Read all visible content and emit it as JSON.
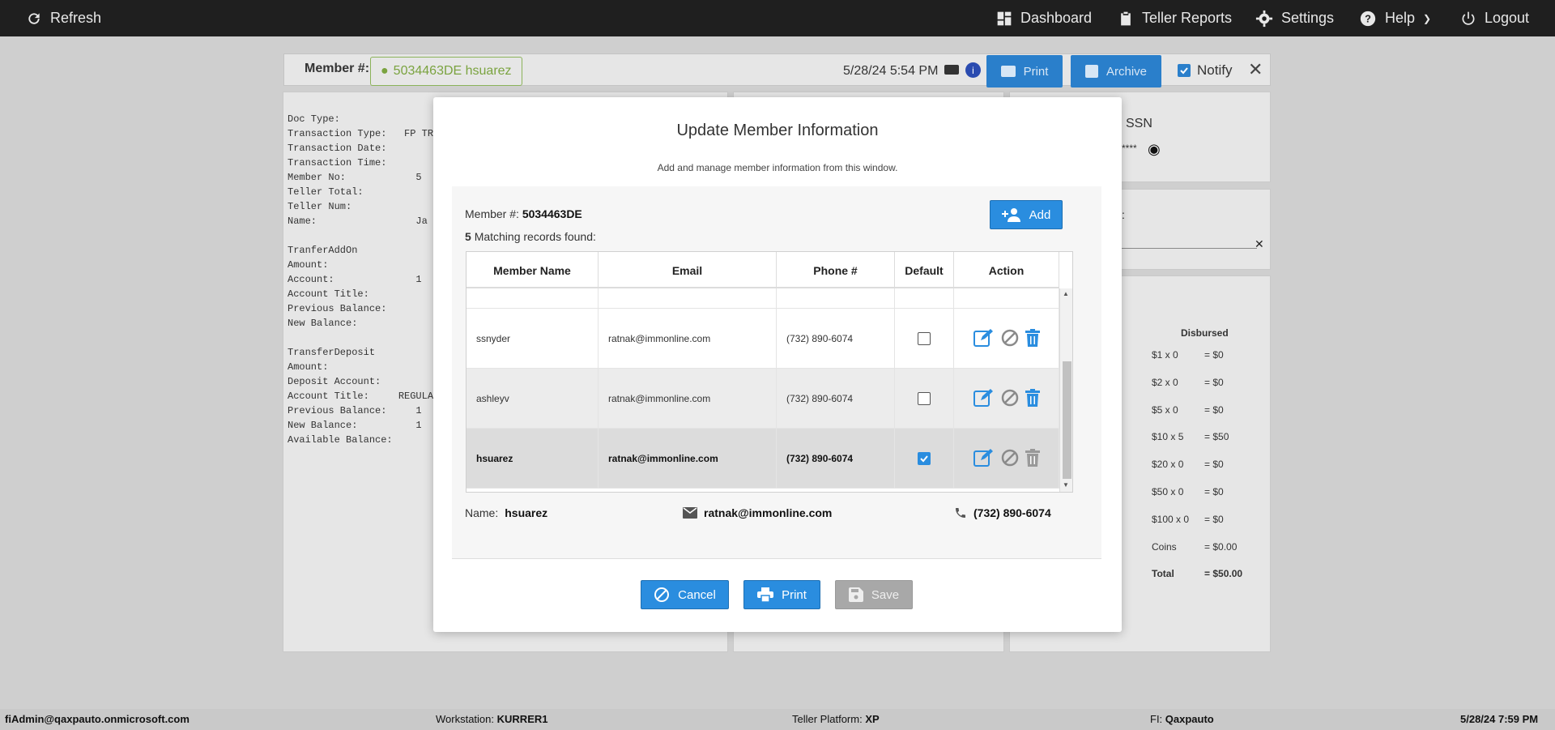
{
  "topbar": {
    "refresh": "Refresh",
    "dashboard": "Dashboard",
    "teller_reports": "Teller Reports",
    "settings": "Settings",
    "help": "Help",
    "logout": "Logout"
  },
  "member_bar": {
    "label": "Member #:",
    "chip": "5034463DE hsuarez",
    "datetime": "5/28/24 5:54 PM",
    "print": "Print",
    "archive": "Archive",
    "notify": "Notify"
  },
  "receipt": {
    "text": "Doc Type:\nTransaction Type:   FP TRA\nTransaction Date:\nTransaction Time:\nMember No:            5\nTeller Total:\nTeller Num:\nName:                 Ja\n\nTranferAddOn\nAmount:\nAccount:              1\nAccount Title:\nPrevious Balance:\nNew Balance:\n\nTransferDeposit\nAmount:\nDeposit Account:\nAccount Title:     REGULAR\nPrevious Balance:     1\nNew Balance:          1\nAvailable Balance:"
  },
  "right_panel": {
    "ssn_label": "SSN",
    "ssn_mask": "****",
    "colon": ":",
    "disbursed_header": "Disbursed",
    "cash_rows": [
      {
        "denom": "$1 x 0",
        "amount": "= $0"
      },
      {
        "denom": "$2 x 0",
        "amount": "= $0"
      },
      {
        "denom": "$5 x 0",
        "amount": "= $0"
      },
      {
        "denom": "$10 x 5",
        "amount": "= $50"
      },
      {
        "denom": "$20 x 0",
        "amount": "= $0"
      },
      {
        "denom": "$50 x 0",
        "amount": "= $0"
      },
      {
        "denom": "$100 x 0",
        "amount": "= $0"
      },
      {
        "denom": "Coins",
        "amount": "= $0.00"
      },
      {
        "denom": "Total",
        "amount": "= $50.00"
      }
    ]
  },
  "modal": {
    "title": "Update Member Information",
    "subtitle": "Add and manage member information from this window.",
    "member_label": "Member #:",
    "member_number": "5034463DE",
    "count": "5",
    "count_text": "Matching records found:",
    "add_label": "Add",
    "columns": [
      "Member Name",
      "Email",
      "Phone #",
      "Default",
      "Action"
    ],
    "rows": [
      {
        "name": "ssnyder",
        "email": "ratnak@immonline.com",
        "phone": "(732) 890-6074",
        "default": false
      },
      {
        "name": "ashleyv",
        "email": "ratnak@immonline.com",
        "phone": "(732) 890-6074",
        "default": false
      },
      {
        "name": "hsuarez",
        "email": "ratnak@immonline.com",
        "phone": "(732) 890-6074",
        "default": true
      }
    ],
    "selected": {
      "name_label": "Name:",
      "name": "hsuarez",
      "email": "ratnak@immonline.com",
      "phone": "(732) 890-6074"
    },
    "cancel": "Cancel",
    "print": "Print",
    "save": "Save"
  },
  "status_bar": {
    "user": "fiAdmin@qaxpauto.onmicrosoft.com",
    "workstation_label": "Workstation:",
    "workstation": "KURRER1",
    "platform_label": "Teller Platform:",
    "platform": "XP",
    "fi_label": "FI:",
    "fi": "Qaxpauto",
    "datetime": "5/28/24 7:59 PM"
  },
  "colors": {
    "accent": "#2a8ddf",
    "topbar": "#1f1f1f",
    "member_chip": "#7aa33f"
  }
}
